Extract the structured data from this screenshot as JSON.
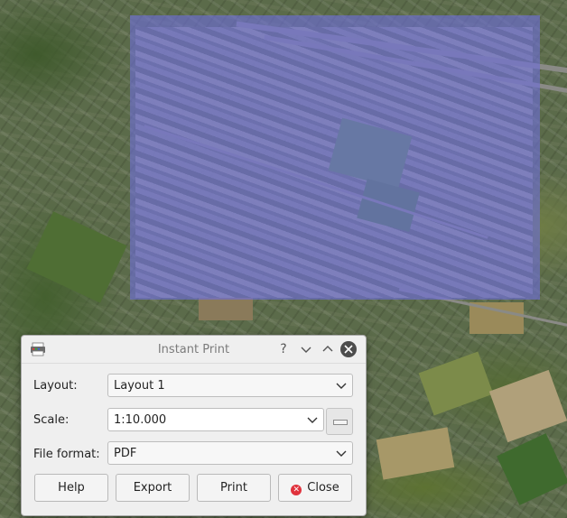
{
  "dialog": {
    "title": "Instant Print",
    "app_icon": "printer-icon",
    "titlebar_buttons": [
      "?",
      "∨",
      "∧",
      "✕"
    ],
    "layout_label": "Layout:",
    "layout_value": "Layout 1",
    "scale_label": "Scale:",
    "scale_value": "1:10.000",
    "format_label": "File format:",
    "format_value": "PDF",
    "buttons": {
      "help": "Help",
      "export": "Export",
      "print": "Print",
      "close": "Close"
    }
  },
  "colors": {
    "print_extent_overlay": "#6e6edc",
    "close_icon": "#e0333d",
    "dialog_bg": "#efefef"
  }
}
